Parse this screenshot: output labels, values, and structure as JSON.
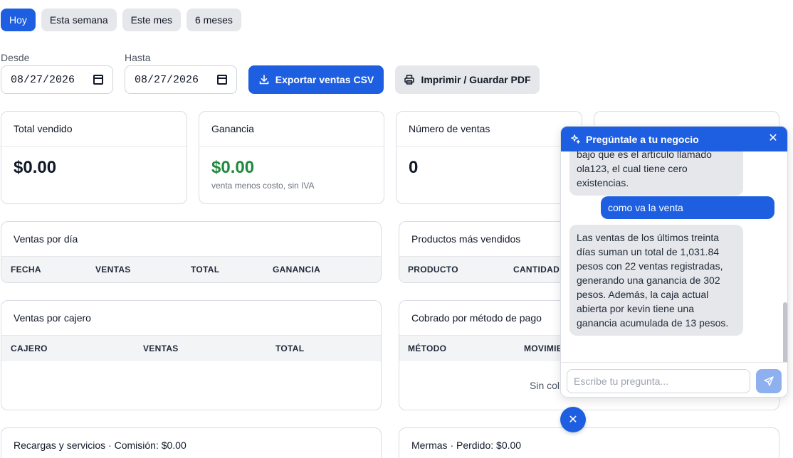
{
  "range_tabs": [
    "Hoy",
    "Esta semana",
    "Este mes",
    "6 meses"
  ],
  "filters": {
    "desde_label": "Desde",
    "desde_value": "08/27/2026",
    "hasta_label": "Hasta",
    "hasta_value": "08/27/2026"
  },
  "actions": {
    "export_label": "Exportar ventas CSV",
    "print_label": "Imprimir / Guardar PDF"
  },
  "stats": {
    "total": {
      "title": "Total vendido",
      "value": "$0.00"
    },
    "ganancia": {
      "title": "Ganancia",
      "value": "$0.00",
      "sub": "venta menos costo, sin IVA"
    },
    "numero": {
      "title": "Número de ventas",
      "value": "0"
    }
  },
  "ventas_dia": {
    "title": "Ventas por día",
    "columns": [
      "FECHA",
      "VENTAS",
      "TOTAL",
      "GANANCIA"
    ]
  },
  "productos": {
    "title": "Productos más vendidos",
    "columns": [
      "PRODUCTO",
      "CANTIDAD"
    ]
  },
  "cajero": {
    "title": "Ventas por cajero",
    "columns": [
      "CAJERO",
      "VENTAS",
      "TOTAL"
    ]
  },
  "metodo": {
    "title": "Cobrado por método de pago",
    "columns": [
      "MÉTODO",
      "MOVIMIE"
    ],
    "empty": "Sin col"
  },
  "recargas": {
    "title": "Recargas y servicios · Comisión: $0.00"
  },
  "mermas": {
    "title": "Mermas · Perdido: $0.00"
  },
  "chat": {
    "title": "Pregúntale a tu negocio",
    "ai_message_1": "bajo que es el artículo llamado ola123, el cual tiene cero existencias.",
    "user_message": "como va la venta",
    "ai_message_2": "Las ventas de los últimos treinta días suman un total de 1,031.84 pesos con 22 ventas registradas, generando una ganancia de 302 pesos. Además, la caja actual abierta por kevin tiene una ganancia acumulada de 13 pesos.",
    "input_placeholder": "Escribe tu pregunta..."
  },
  "colors": {
    "primary": "#1d5fe0",
    "profit_green": "#1f8a3d",
    "muted_bg": "#e5e7eb"
  }
}
